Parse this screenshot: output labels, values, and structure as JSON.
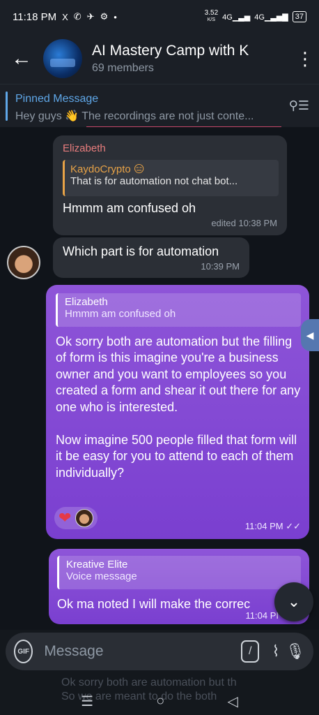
{
  "status": {
    "time": "11:18 PM",
    "icons": [
      "X",
      "✆",
      "✈",
      "⚙",
      "•"
    ],
    "net_speed": "3.52",
    "net_unit": "K/S",
    "signal1": "4G",
    "signal2": "4G",
    "battery": "37"
  },
  "header": {
    "title": "AI Mastery Camp with K",
    "subtitle": "69 members"
  },
  "pinned": {
    "title": "Pinned Message",
    "text": "Hey guys 👋  The recordings are not just conte..."
  },
  "messages": {
    "m1": {
      "sender": "Elizabeth",
      "quote_name": "KaydoCrypto 😑",
      "quote_text": "That is for automation not chat bot...",
      "text": "Hmmm am confused oh",
      "meta": "edited 10:38 PM"
    },
    "m2": {
      "text": "Which part is for automation",
      "meta": "10:39 PM"
    },
    "m3": {
      "quote_name": "Elizabeth",
      "quote_text": "Hmmm am confused oh",
      "text_p1": "Ok sorry both are automation but the filling of form is this imagine you're a business owner and you want to employees so you created a form and shear it out there for any one who is interested.",
      "text_p2": "Now imagine 500 people filled that form will it be easy for you to attend to each of them individually?",
      "meta": "11:04 PM",
      "reaction": "❤"
    },
    "m4": {
      "quote_name": "Kreative Elite",
      "quote_text": "Voice message",
      "text": "Ok ma noted I will make the correc",
      "meta": "11:04 PI"
    }
  },
  "input": {
    "placeholder": "Message",
    "gif_label": "GIF",
    "cmd_label": "/"
  },
  "ghost_text": {
    "line1": "Ok sorry both are automation but th",
    "line2": "So we are meant to do the both"
  }
}
